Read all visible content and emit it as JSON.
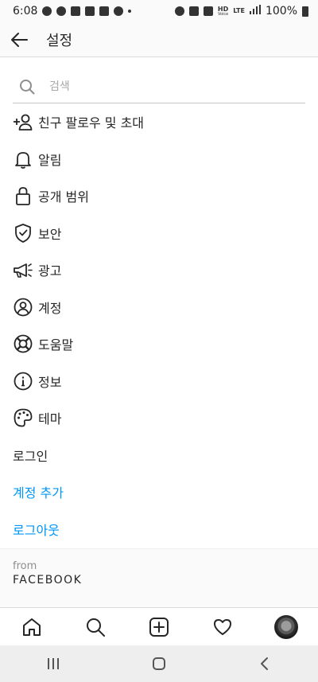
{
  "status_bar": {
    "time": "6:08",
    "network_hd": "HD",
    "network_voice": "Voice",
    "network_lte": "LTE",
    "battery_percent": "100%"
  },
  "header": {
    "title": "설정",
    "back_icon": "arrow-left-icon"
  },
  "search": {
    "placeholder": "검색",
    "icon": "search-icon"
  },
  "menu": {
    "items": [
      {
        "label": "친구 팔로우 및 초대",
        "icon": "add-person-icon"
      },
      {
        "label": "알림",
        "icon": "bell-icon"
      },
      {
        "label": "공개 범위",
        "icon": "lock-icon"
      },
      {
        "label": "보안",
        "icon": "shield-check-icon"
      },
      {
        "label": "광고",
        "icon": "megaphone-icon"
      },
      {
        "label": "계정",
        "icon": "user-circle-icon"
      },
      {
        "label": "도움말",
        "icon": "lifebuoy-icon"
      },
      {
        "label": "정보",
        "icon": "info-icon"
      },
      {
        "label": "테마",
        "icon": "palette-icon"
      }
    ],
    "login": "로그인",
    "add_account": "계정 추가",
    "logout": "로그아웃"
  },
  "footer": {
    "from": "from",
    "brand": "FACEBOOK"
  },
  "tabbar": {
    "tabs": [
      "home-icon",
      "search-icon",
      "add-post-icon",
      "heart-icon",
      "profile-avatar"
    ]
  },
  "colors": {
    "link": "#0095f6",
    "text": "#262626",
    "muted": "#8e8e8e"
  }
}
